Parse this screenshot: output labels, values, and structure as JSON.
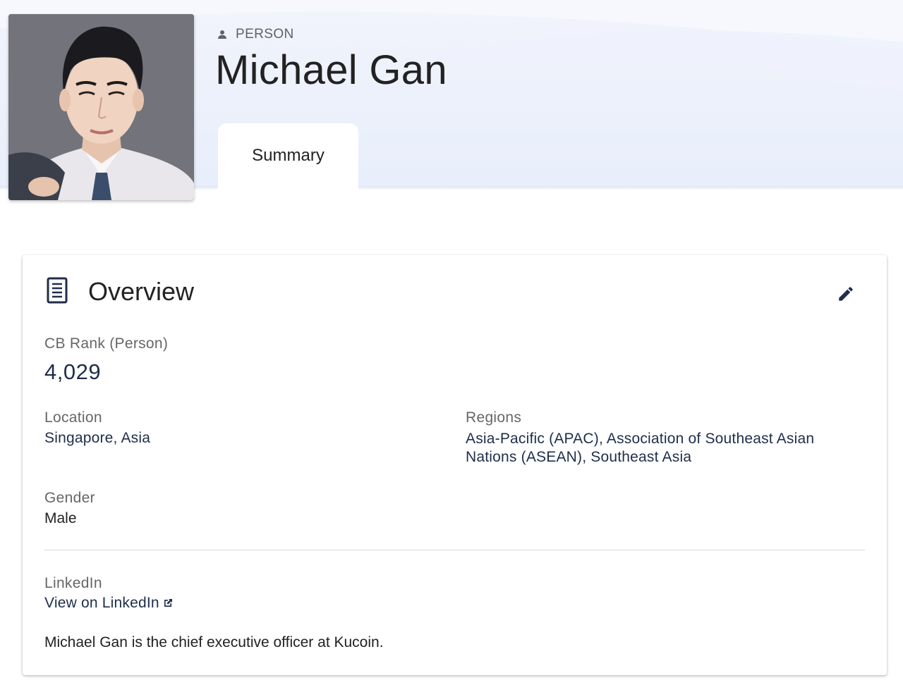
{
  "header": {
    "entity_type": "PERSON",
    "name": "Michael Gan",
    "person_icon": "person-icon"
  },
  "tabs": [
    {
      "label": "Summary",
      "active": true
    }
  ],
  "overview": {
    "title": "Overview",
    "title_icon": "document-icon",
    "edit_icon": "pencil-icon",
    "cb_rank": {
      "label": "CB Rank (Person)",
      "value": "4,029"
    },
    "location": {
      "label": "Location",
      "city": "Singapore",
      "separator": ", ",
      "region": "Asia"
    },
    "regions": {
      "label": "Regions",
      "items": [
        {
          "text": "Asia-Pacific (APAC)",
          "separator": ", "
        },
        {
          "text": "Association of Southeast Asian Nations (ASEAN)",
          "separator": ", "
        },
        {
          "text": "Southeast Asia",
          "separator": ""
        }
      ]
    },
    "gender": {
      "label": "Gender",
      "value": "Male"
    },
    "linkedin": {
      "label": "LinkedIn",
      "link_text": "View on LinkedIn",
      "icon": "external-link-icon"
    },
    "description": "Michael Gan is the chief executive officer at Kucoin."
  },
  "colors": {
    "header_bg": "#e8eefb",
    "link": "#1f2e4a",
    "label": "#666666"
  }
}
